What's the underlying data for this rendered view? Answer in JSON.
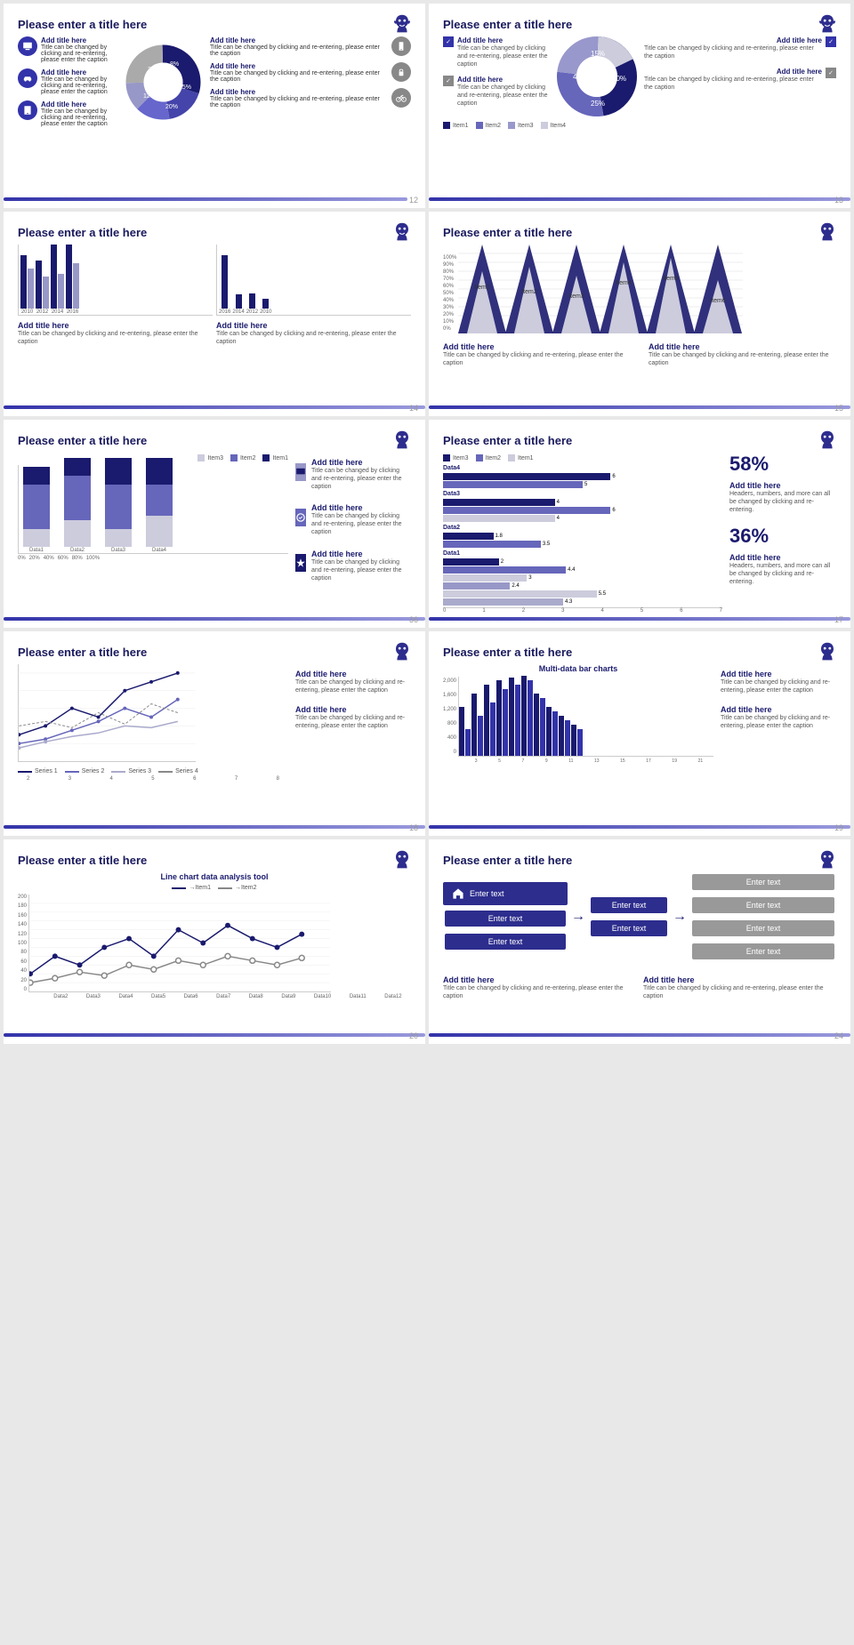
{
  "slides": [
    {
      "number": "12",
      "title": "Please enter a title here",
      "type": "icon-pie"
    },
    {
      "number": "13",
      "title": "Please enter a title here",
      "type": "donut-legend"
    },
    {
      "number": "14",
      "title": "Please enter a title here",
      "type": "dual-bar"
    },
    {
      "number": "15",
      "title": "Please enter a title here",
      "type": "pyramid"
    },
    {
      "number": "36",
      "title": "Please enter a title here",
      "type": "stacked-bar"
    },
    {
      "number": "17",
      "title": "Please enter a title here",
      "type": "hbar-pct"
    },
    {
      "number": "18",
      "title": "Please enter a title here",
      "type": "line-chart"
    },
    {
      "number": "19",
      "title": "Please enter a title here",
      "type": "multi-bar"
    },
    {
      "number": "20",
      "title": "Please enter a title here",
      "type": "line-analysis"
    },
    {
      "number": "24",
      "title": "Please enter a title here",
      "type": "text-boxes"
    }
  ],
  "add_title": "Add title here",
  "add_caption": "Title can be changed by clicking and re-entering, please enter the caption",
  "enter_text": "Enter text",
  "slide_title_placeholder": "Please enter a title here"
}
